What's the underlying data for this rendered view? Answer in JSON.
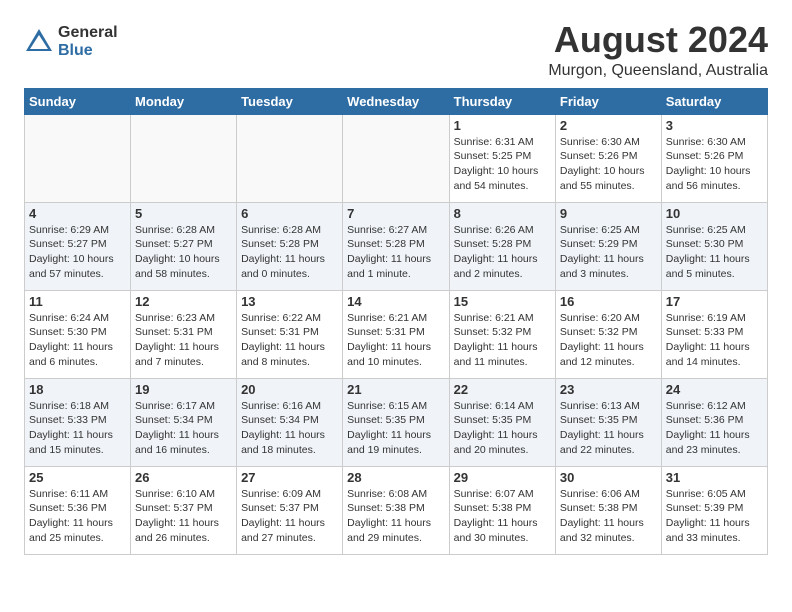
{
  "header": {
    "logo_general": "General",
    "logo_blue": "Blue",
    "month_year": "August 2024",
    "location": "Murgon, Queensland, Australia"
  },
  "calendar": {
    "days_of_week": [
      "Sunday",
      "Monday",
      "Tuesday",
      "Wednesday",
      "Thursday",
      "Friday",
      "Saturday"
    ],
    "weeks": [
      [
        {
          "day": "",
          "info": ""
        },
        {
          "day": "",
          "info": ""
        },
        {
          "day": "",
          "info": ""
        },
        {
          "day": "",
          "info": ""
        },
        {
          "day": "1",
          "info": "Sunrise: 6:31 AM\nSunset: 5:25 PM\nDaylight: 10 hours\nand 54 minutes."
        },
        {
          "day": "2",
          "info": "Sunrise: 6:30 AM\nSunset: 5:26 PM\nDaylight: 10 hours\nand 55 minutes."
        },
        {
          "day": "3",
          "info": "Sunrise: 6:30 AM\nSunset: 5:26 PM\nDaylight: 10 hours\nand 56 minutes."
        }
      ],
      [
        {
          "day": "4",
          "info": "Sunrise: 6:29 AM\nSunset: 5:27 PM\nDaylight: 10 hours\nand 57 minutes."
        },
        {
          "day": "5",
          "info": "Sunrise: 6:28 AM\nSunset: 5:27 PM\nDaylight: 10 hours\nand 58 minutes."
        },
        {
          "day": "6",
          "info": "Sunrise: 6:28 AM\nSunset: 5:28 PM\nDaylight: 11 hours\nand 0 minutes."
        },
        {
          "day": "7",
          "info": "Sunrise: 6:27 AM\nSunset: 5:28 PM\nDaylight: 11 hours\nand 1 minute."
        },
        {
          "day": "8",
          "info": "Sunrise: 6:26 AM\nSunset: 5:28 PM\nDaylight: 11 hours\nand 2 minutes."
        },
        {
          "day": "9",
          "info": "Sunrise: 6:25 AM\nSunset: 5:29 PM\nDaylight: 11 hours\nand 3 minutes."
        },
        {
          "day": "10",
          "info": "Sunrise: 6:25 AM\nSunset: 5:30 PM\nDaylight: 11 hours\nand 5 minutes."
        }
      ],
      [
        {
          "day": "11",
          "info": "Sunrise: 6:24 AM\nSunset: 5:30 PM\nDaylight: 11 hours\nand 6 minutes."
        },
        {
          "day": "12",
          "info": "Sunrise: 6:23 AM\nSunset: 5:31 PM\nDaylight: 11 hours\nand 7 minutes."
        },
        {
          "day": "13",
          "info": "Sunrise: 6:22 AM\nSunset: 5:31 PM\nDaylight: 11 hours\nand 8 minutes."
        },
        {
          "day": "14",
          "info": "Sunrise: 6:21 AM\nSunset: 5:31 PM\nDaylight: 11 hours\nand 10 minutes."
        },
        {
          "day": "15",
          "info": "Sunrise: 6:21 AM\nSunset: 5:32 PM\nDaylight: 11 hours\nand 11 minutes."
        },
        {
          "day": "16",
          "info": "Sunrise: 6:20 AM\nSunset: 5:32 PM\nDaylight: 11 hours\nand 12 minutes."
        },
        {
          "day": "17",
          "info": "Sunrise: 6:19 AM\nSunset: 5:33 PM\nDaylight: 11 hours\nand 14 minutes."
        }
      ],
      [
        {
          "day": "18",
          "info": "Sunrise: 6:18 AM\nSunset: 5:33 PM\nDaylight: 11 hours\nand 15 minutes."
        },
        {
          "day": "19",
          "info": "Sunrise: 6:17 AM\nSunset: 5:34 PM\nDaylight: 11 hours\nand 16 minutes."
        },
        {
          "day": "20",
          "info": "Sunrise: 6:16 AM\nSunset: 5:34 PM\nDaylight: 11 hours\nand 18 minutes."
        },
        {
          "day": "21",
          "info": "Sunrise: 6:15 AM\nSunset: 5:35 PM\nDaylight: 11 hours\nand 19 minutes."
        },
        {
          "day": "22",
          "info": "Sunrise: 6:14 AM\nSunset: 5:35 PM\nDaylight: 11 hours\nand 20 minutes."
        },
        {
          "day": "23",
          "info": "Sunrise: 6:13 AM\nSunset: 5:35 PM\nDaylight: 11 hours\nand 22 minutes."
        },
        {
          "day": "24",
          "info": "Sunrise: 6:12 AM\nSunset: 5:36 PM\nDaylight: 11 hours\nand 23 minutes."
        }
      ],
      [
        {
          "day": "25",
          "info": "Sunrise: 6:11 AM\nSunset: 5:36 PM\nDaylight: 11 hours\nand 25 minutes."
        },
        {
          "day": "26",
          "info": "Sunrise: 6:10 AM\nSunset: 5:37 PM\nDaylight: 11 hours\nand 26 minutes."
        },
        {
          "day": "27",
          "info": "Sunrise: 6:09 AM\nSunset: 5:37 PM\nDaylight: 11 hours\nand 27 minutes."
        },
        {
          "day": "28",
          "info": "Sunrise: 6:08 AM\nSunset: 5:38 PM\nDaylight: 11 hours\nand 29 minutes."
        },
        {
          "day": "29",
          "info": "Sunrise: 6:07 AM\nSunset: 5:38 PM\nDaylight: 11 hours\nand 30 minutes."
        },
        {
          "day": "30",
          "info": "Sunrise: 6:06 AM\nSunset: 5:38 PM\nDaylight: 11 hours\nand 32 minutes."
        },
        {
          "day": "31",
          "info": "Sunrise: 6:05 AM\nSunset: 5:39 PM\nDaylight: 11 hours\nand 33 minutes."
        }
      ]
    ]
  }
}
